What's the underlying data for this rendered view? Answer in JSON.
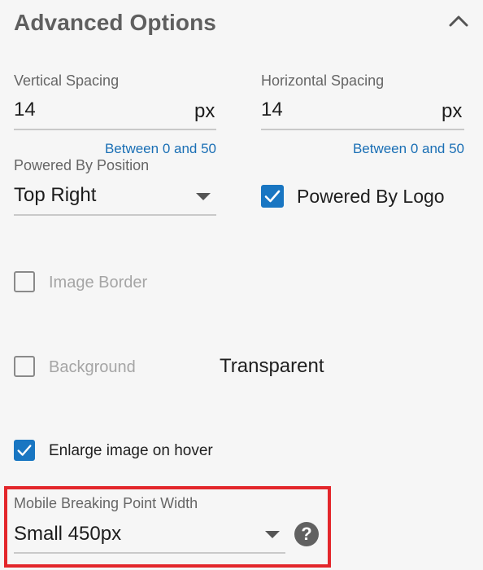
{
  "section": {
    "title": "Advanced Options",
    "collapse_icon": "chevron-up-icon"
  },
  "vertical_spacing": {
    "label": "Vertical Spacing",
    "value": "14",
    "unit": "px",
    "hint": "Between 0 and 50"
  },
  "horizontal_spacing": {
    "label": "Horizontal Spacing",
    "value": "14",
    "unit": "px",
    "hint": "Between 0 and 50"
  },
  "powered_by_position": {
    "label": "Powered By Position",
    "selected": "Top Right",
    "icon": "dropdown-arrow-icon"
  },
  "powered_by_logo": {
    "label": "Powered By Logo",
    "checked": true
  },
  "image_border": {
    "label": "Image Border",
    "checked": false,
    "disabled": true
  },
  "background": {
    "label": "Background",
    "checked": false,
    "disabled": true,
    "value": "Transparent"
  },
  "enlarge_on_hover": {
    "label": "Enlarge image on hover",
    "checked": true
  },
  "mobile_breaking_point": {
    "label": "Mobile Breaking Point Width",
    "selected": "Small 450px",
    "help_icon": "question-mark-icon",
    "help_glyph": "?"
  },
  "colors": {
    "accent": "#1976c2",
    "hint": "#1a6fb5",
    "highlight": "#e3262b",
    "background": "#f6f6f6"
  }
}
